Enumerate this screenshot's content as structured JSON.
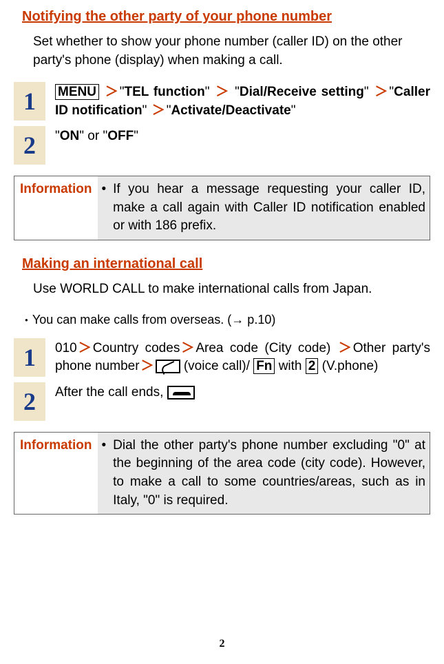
{
  "section1": {
    "heading": "Notifying the other party of your phone number",
    "intro": "Set whether to show your phone number (caller ID) on the other party's phone (display) when making a call.",
    "step1": {
      "num": "1",
      "menu": "MENU",
      "tel": "TEL function",
      "dial": "Dial/Receive setting",
      "caller": "Caller ID notification",
      "activate": "Activate/Deactivate"
    },
    "step2": {
      "num": "2",
      "on": "ON",
      "or": "\" or \"",
      "off": "OFF"
    },
    "info": {
      "label": "Information",
      "text": "If you hear a message requesting your caller ID, make a call again with Caller ID notification enabled or with 186 prefix."
    }
  },
  "section2": {
    "heading": "Making an international call",
    "intro": "Use WORLD CALL to make international calls from Japan.",
    "note": "You can make calls from overseas. (→ p.10)",
    "step1": {
      "num": "1",
      "p1": "010",
      "p2": "Country codes",
      "p3": "Area code (City code) ",
      "p4": "Other party's phone number",
      "p5": " (voice call)/ ",
      "fn": "Fn",
      "p6": " with ",
      "two": "2",
      "p7": " (V.phone)"
    },
    "step2": {
      "num": "2",
      "text": "After the call ends, "
    },
    "info": {
      "label": "Information",
      "text": "Dial the other party's phone number excluding \"0\" at the beginning of the area code (city code). However, to make a call to some countries/areas, such as in Italy, \"0\" is required."
    }
  },
  "pageNumber": "2"
}
